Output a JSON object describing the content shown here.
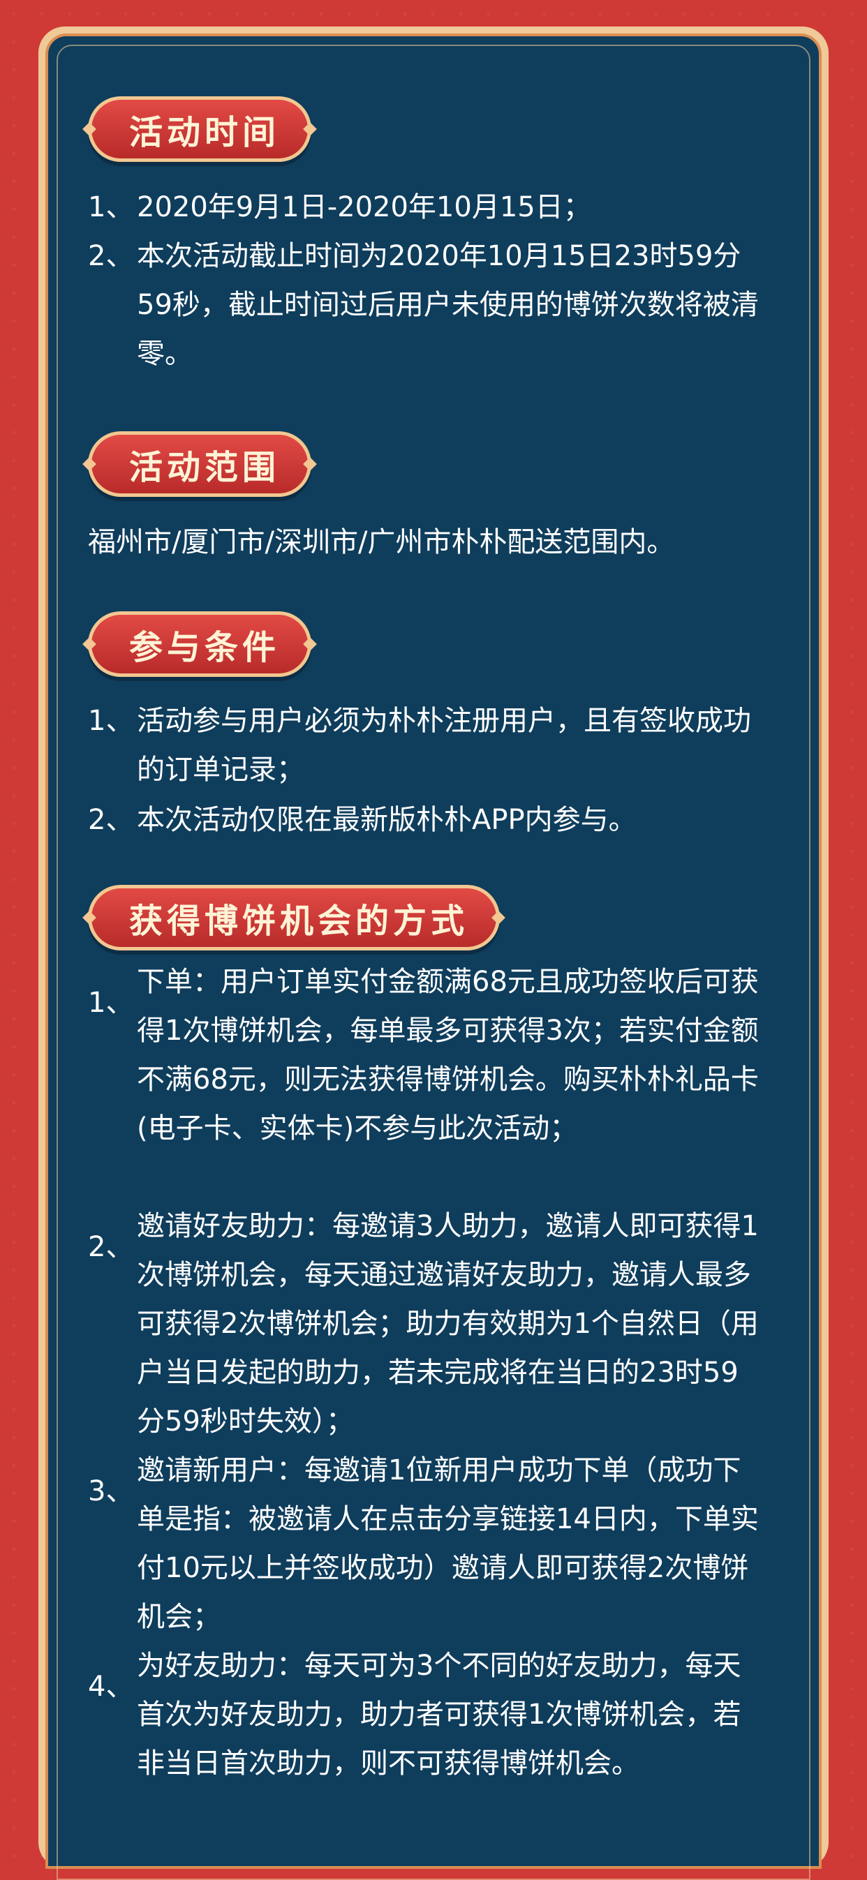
{
  "sections": {
    "time": {
      "title": "活动时间",
      "items": [
        {
          "num": "1、",
          "text": "2020年9月1日-2020年10月15日；"
        },
        {
          "num": "2、",
          "text": "本次活动截止时间为2020年10月15日23时59分59秒，截止时间过后用户未使用的博饼次数将被清零。"
        }
      ]
    },
    "scope": {
      "title": "活动范围",
      "text": "福州市/厦门市/深圳市/广州市朴朴配送范围内。"
    },
    "conditions": {
      "title": "参与条件",
      "items": [
        {
          "num": "1、",
          "text": "活动参与用户必须为朴朴注册用户，且有签收成功的订单记录；"
        },
        {
          "num": "2、",
          "text": "本次活动仅限在最新版朴朴APP内参与。"
        }
      ]
    },
    "methods": {
      "title": "获得博饼机会的方式",
      "items": [
        {
          "num": "1、",
          "text": "下单：用户订单实付金额满68元且成功签收后可获得1次博饼机会，每单最多可获得3次；若实付金额不满68元，则无法获得博饼机会。购买朴朴礼品卡(电子卡、实体卡)不参与此次活动；"
        },
        {
          "num": "2、",
          "text": "邀请好友助力：每邀请3人助力，邀请人即可获得1次博饼机会，每天通过邀请好友助力，邀请人最多可获得2次博饼机会；助力有效期为1个自然日（用户当日发起的助力，若未完成将在当日的23时59分59秒时失效）；"
        },
        {
          "num": "3、",
          "text": "邀请新用户：每邀请1位新用户成功下单（成功下单是指：被邀请人在点击分享链接14日内，下单实付10元以上并签收成功）邀请人即可获得2次博饼机会；"
        },
        {
          "num": "4、",
          "text": "为好友助力：每天可为3个不同的好友助力，每天首次为好友助力，助力者可获得1次博饼机会，若非当日首次助力，则不可获得博饼机会。"
        }
      ]
    }
  }
}
